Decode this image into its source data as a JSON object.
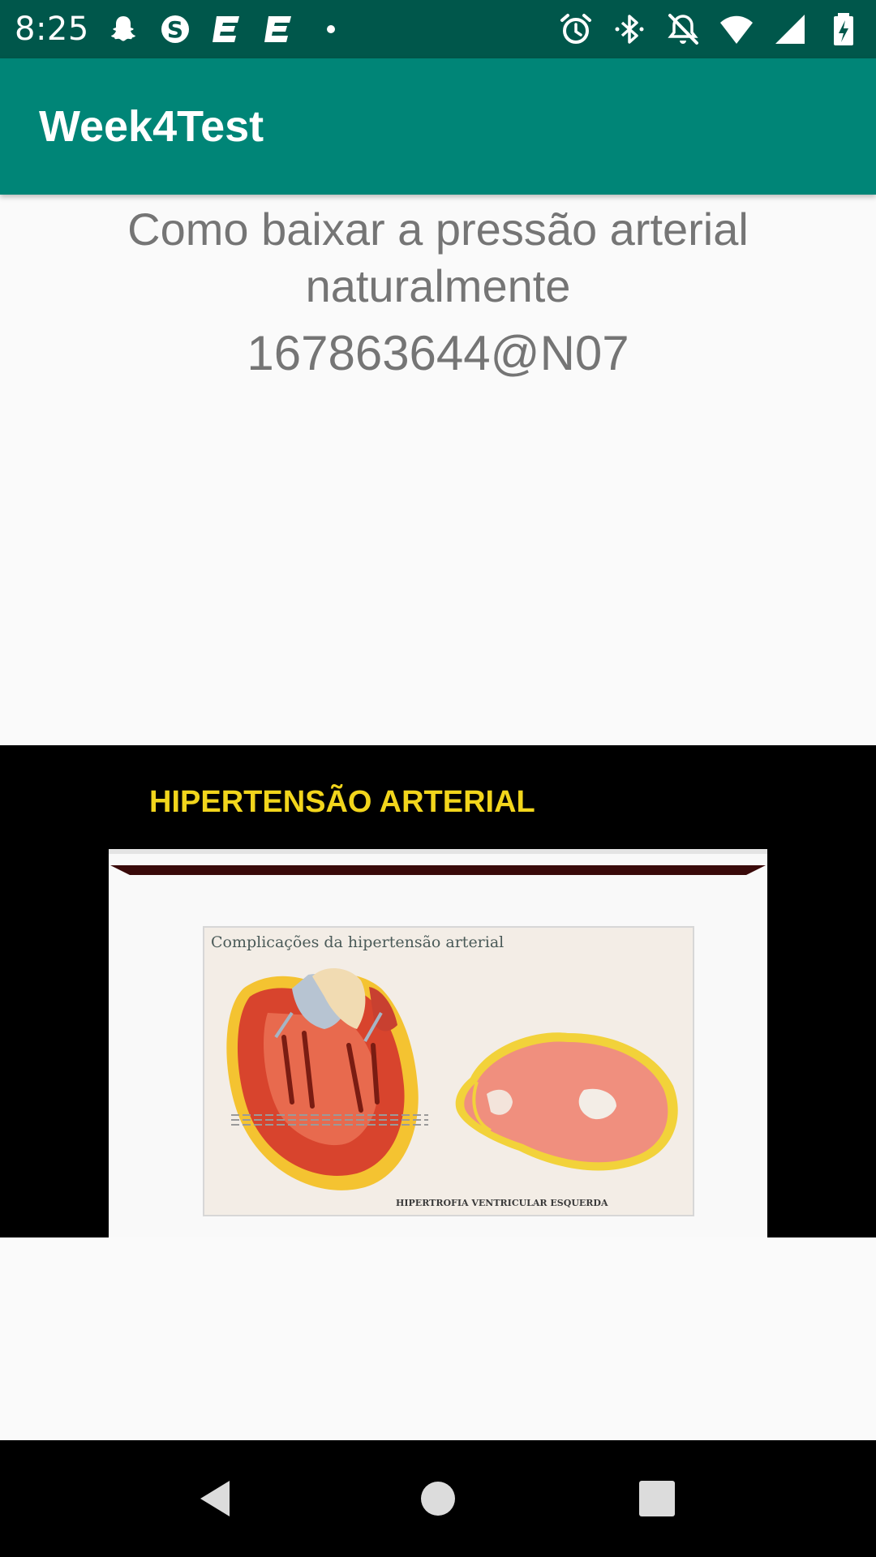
{
  "status_bar": {
    "time": "8:25",
    "left_icons": [
      "snapchat-icon",
      "skype-icon",
      "notification-e-icon",
      "notification-e-icon",
      "dot-icon"
    ],
    "right_icons": [
      "alarm-icon",
      "bluetooth-icon",
      "do-not-disturb-icon",
      "wifi-icon",
      "cell-signal-icon",
      "battery-charging-icon"
    ]
  },
  "app_bar": {
    "title": "Week4Test"
  },
  "content": {
    "title": "Como baixar a pressão arterial naturalmente",
    "id": "167863644@N07"
  },
  "image": {
    "heading": "HIPERTENSÃO ARTERIAL",
    "caption": "Complicações da hipertensão arterial",
    "label": "HIPERTROFIA VENTRICULAR ESQUERDA"
  },
  "nav_bar": {
    "buttons": [
      "back",
      "home",
      "recents"
    ]
  },
  "colors": {
    "status_bar": "#00574b",
    "app_bar": "#008577",
    "text_gray": "#757575",
    "heading_yellow": "#f2d51c"
  }
}
